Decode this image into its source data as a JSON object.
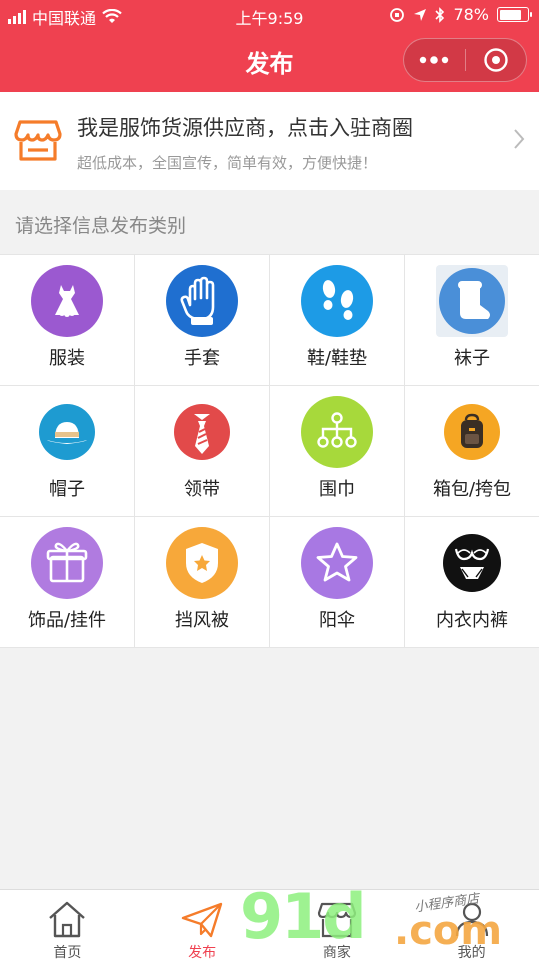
{
  "status_bar": {
    "carrier": "中国联通",
    "time": "上午9:59",
    "battery": "78%",
    "battery_level": 0.78
  },
  "nav": {
    "title": "发布",
    "more_icon": "more-dots-icon",
    "close_icon": "target-circle-icon"
  },
  "banner": {
    "title": "我是服饰货源供应商，点击入驻商圈",
    "subtitle": "超低成本，全国宣传，简单有效，方便快捷！",
    "icon": "store-icon"
  },
  "section_label": "请选择信息发布类别",
  "categories": [
    {
      "label": "服装",
      "icon": "dress-icon",
      "color": "#9b59d0"
    },
    {
      "label": "手套",
      "icon": "glove-icon",
      "color": "#1f6fd0"
    },
    {
      "label": "鞋/鞋垫",
      "icon": "footprints-icon",
      "color": "#1d9be6"
    },
    {
      "label": "袜子",
      "icon": "sock-icon",
      "color": "#4a8fd8"
    },
    {
      "label": "帽子",
      "icon": "hat-icon",
      "color": "#1e9bd1"
    },
    {
      "label": "领带",
      "icon": "tie-icon",
      "color": "#e24a4a"
    },
    {
      "label": "围巾",
      "icon": "network-icon",
      "color": "#a7d93b"
    },
    {
      "label": "箱包/挎包",
      "icon": "backpack-icon",
      "color": "#f5a623"
    },
    {
      "label": "饰品/挂件",
      "icon": "gift-icon",
      "color": "#b07be0"
    },
    {
      "label": "挡风被",
      "icon": "shield-star-icon",
      "color": "#f7a83a"
    },
    {
      "label": "阳伞",
      "icon": "star-icon",
      "color": "#a878e3"
    },
    {
      "label": "内衣内裤",
      "icon": "lingerie-icon",
      "color": "#111111"
    }
  ],
  "tabs": [
    {
      "label": "首页",
      "icon": "home-icon"
    },
    {
      "label": "发布",
      "icon": "paper-plane-icon"
    },
    {
      "label": "商家",
      "icon": "shop-icon"
    },
    {
      "label": "我的",
      "icon": "user-icon"
    }
  ],
  "watermark": {
    "brand": "91",
    "brand2": "d",
    "domain": ".com",
    "tagline": "小程序商店"
  },
  "colors": {
    "brand_red": "#ef4150",
    "accent_orange": "#f57c2a"
  }
}
